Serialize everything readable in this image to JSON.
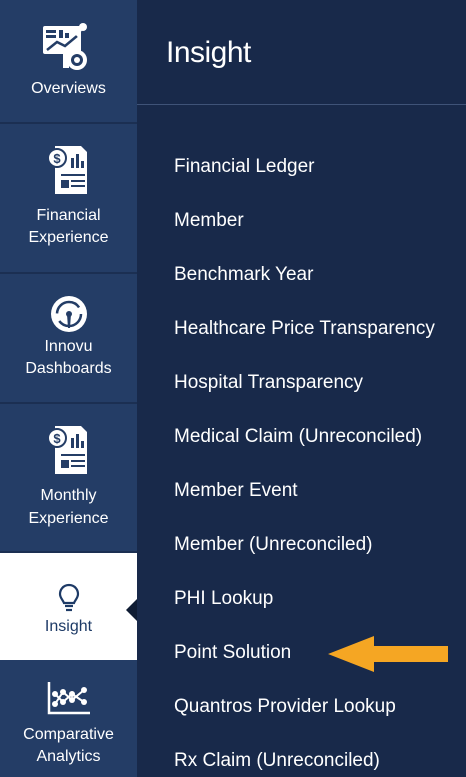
{
  "sidebar": {
    "items": [
      {
        "label": "Overviews",
        "icon": "dashboard-report-icon"
      },
      {
        "label_line1": "Financial",
        "label_line2": "Experience",
        "icon": "financial-report-icon"
      },
      {
        "label_line1": "Innovu",
        "label_line2": "Dashboards",
        "icon": "gauge-icon"
      },
      {
        "label_line1": "Monthly",
        "label_line2": "Experience",
        "icon": "financial-report-icon"
      },
      {
        "label": "Insight",
        "icon": "lightbulb-icon",
        "active": true
      },
      {
        "label_line1": "Comparative",
        "label_line2": "Analytics",
        "icon": "line-chart-icon"
      }
    ]
  },
  "panel": {
    "title": "Insight",
    "menu": [
      "Financial Ledger",
      "Member",
      "Benchmark Year",
      "Healthcare Price Transparency",
      "Hospital Transparency",
      "Medical Claim (Unreconciled)",
      "Member Event",
      "Member (Unreconciled)",
      "PHI Lookup",
      "Point Solution",
      "Quantros Provider Lookup",
      "Rx Claim (Unreconciled)"
    ]
  },
  "annotation": {
    "icon": "arrow-left-icon",
    "color": "#f5a623"
  },
  "colors": {
    "sidebar": "#243d66",
    "panel": "#18294a",
    "active": "#ffffff",
    "accent": "#f5a623"
  }
}
